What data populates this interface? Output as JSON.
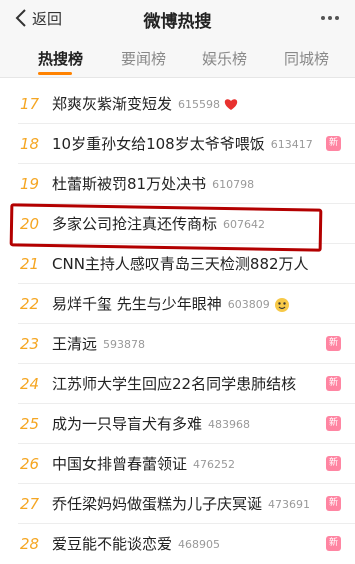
{
  "nav": {
    "back_label": "返回",
    "title": "微博热搜"
  },
  "tabs": [
    "热搜榜",
    "要闻榜",
    "娱乐榜",
    "同城榜"
  ],
  "items": [
    {
      "rank": "17",
      "text": "郑爽灰紫渐变短发",
      "count": "615598",
      "icon": "heart-icon",
      "badge": ""
    },
    {
      "rank": "18",
      "text": "10岁重孙女给108岁太爷爷喂饭",
      "count": "613417",
      "icon": "",
      "badge": "新"
    },
    {
      "rank": "19",
      "text": "杜蕾斯被罚81万处决书",
      "count": "610798",
      "icon": "",
      "badge": ""
    },
    {
      "rank": "20",
      "text": "多家公司抢注真还传商标",
      "count": "607642",
      "icon": "",
      "badge": ""
    },
    {
      "rank": "21",
      "text": "CNN主持人感叹青岛三天检测882万人",
      "count": "",
      "icon": "",
      "badge": ""
    },
    {
      "rank": "22",
      "text": "易烊千玺 先生与少年眼神",
      "count": "603809",
      "icon": "emoji-icon",
      "badge": ""
    },
    {
      "rank": "23",
      "text": "王清远",
      "count": "593878",
      "icon": "",
      "badge": "新"
    },
    {
      "rank": "24",
      "text": "江苏师大学生回应22名同学患肺结核",
      "count": "",
      "icon": "",
      "badge": "新"
    },
    {
      "rank": "25",
      "text": "成为一只导盲犬有多难",
      "count": "483968",
      "icon": "",
      "badge": "新"
    },
    {
      "rank": "26",
      "text": "中国女排曾春蕾领证",
      "count": "476252",
      "icon": "",
      "badge": "新"
    },
    {
      "rank": "27",
      "text": "乔任梁妈妈做蛋糕为儿子庆冥诞",
      "count": "473691",
      "icon": "",
      "badge": "新"
    },
    {
      "rank": "28",
      "text": "爱豆能不能谈恋爱",
      "count": "468905",
      "icon": "",
      "badge": "新"
    }
  ],
  "colors": {
    "accent": "#ff8200",
    "rank": "#f5a623",
    "highlight": "#b30000",
    "badge": "#ff85a2"
  }
}
